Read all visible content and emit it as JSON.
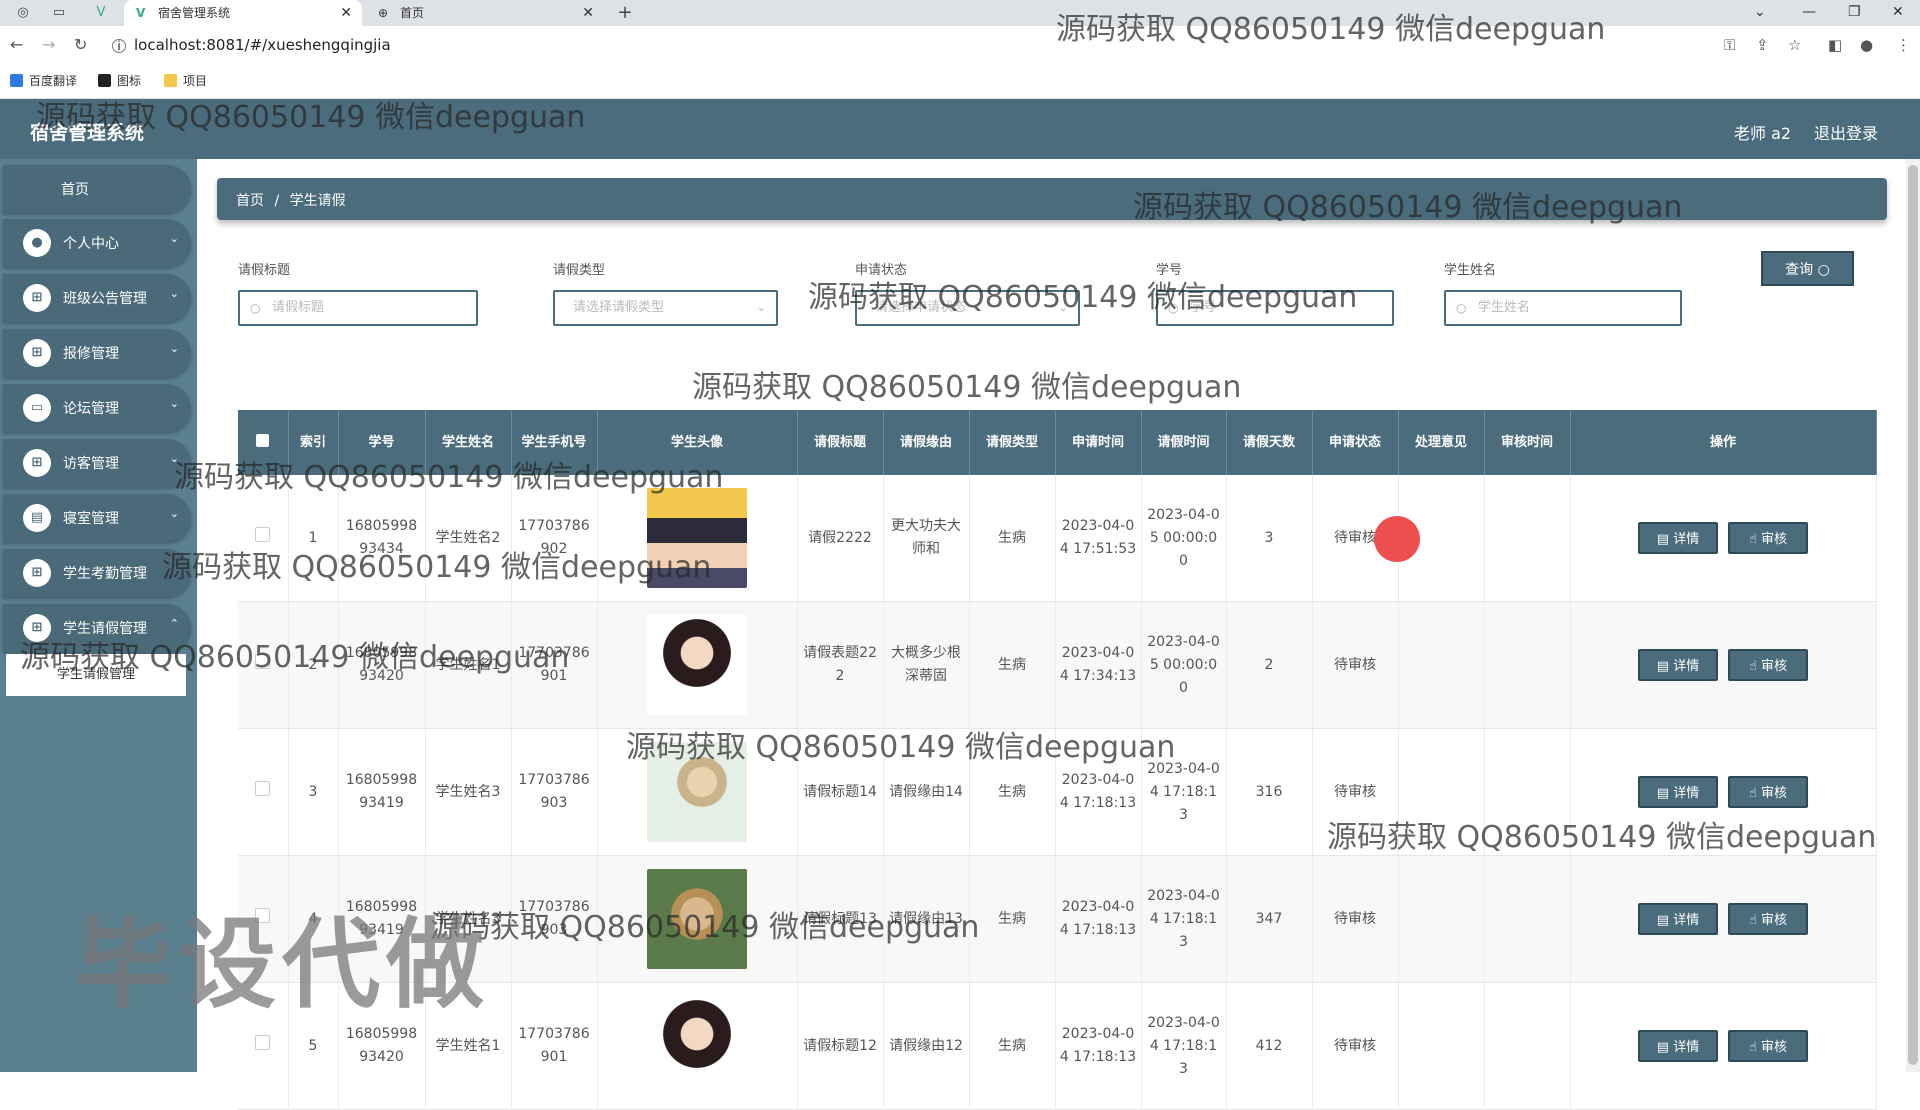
{
  "browser": {
    "tabs": [
      {
        "title": "宿舍管理系统",
        "close": "✕"
      },
      {
        "title": "首页",
        "close": "✕"
      }
    ],
    "new_tab": "+",
    "url": "localhost:8081/#/xueshengqingjia",
    "bookmarks": [
      "百度翻译",
      "图标",
      "项目"
    ]
  },
  "app": {
    "brand": "宿舍管理系统",
    "user": "老师 a2",
    "logout": "退出登录"
  },
  "sidebar": {
    "home": "首页",
    "items": [
      {
        "label": "个人中心"
      },
      {
        "label": "班级公告管理"
      },
      {
        "label": "报修管理"
      },
      {
        "label": "论坛管理"
      },
      {
        "label": "访客管理"
      },
      {
        "label": "寝室管理"
      },
      {
        "label": "学生考勤管理"
      },
      {
        "label": "学生请假管理"
      }
    ],
    "submenu": "学生请假管理"
  },
  "breadcrumb": {
    "home": "首页",
    "sep": "/",
    "current": "学生请假"
  },
  "filters": {
    "title_label": "请假标题",
    "title_placeholder": "请假标题",
    "type_label": "请假类型",
    "type_placeholder": "请选择请假类型",
    "status_label": "申请状态",
    "status_placeholder": "请选择申请状态",
    "id_label": "学号",
    "id_placeholder": "学号",
    "name_label": "学生姓名",
    "name_placeholder": "学生姓名",
    "query": "查询"
  },
  "table": {
    "headers": [
      "索引",
      "学号",
      "学生姓名",
      "学生手机号",
      "学生头像",
      "请假标题",
      "请假缘由",
      "请假类型",
      "申请时间",
      "请假时间",
      "请假天数",
      "申请状态",
      "处理意见",
      "审核时间",
      "操作"
    ],
    "detail_btn": "详情",
    "audit_btn": "审核",
    "rows": [
      {
        "idx": "1",
        "sid": "1680599893434",
        "name": "学生姓名2",
        "phone": "17703786902",
        "title": "请假2222",
        "reason": "更大功夫大师和",
        "type": "生病",
        "apply": "2023-04-04 17:51:53",
        "leave": "2023-04-05 00:00:00",
        "days": "3",
        "status": "待审核",
        "opinion": "",
        "audit_time": ""
      },
      {
        "idx": "2",
        "sid": "1680599893420",
        "name": "学生姓名1",
        "phone": "17703786901",
        "title": "请假表题222",
        "reason": "大概多少根深蒂固",
        "type": "生病",
        "apply": "2023-04-04 17:34:13",
        "leave": "2023-04-05 00:00:00",
        "days": "2",
        "status": "待审核",
        "opinion": "",
        "audit_time": ""
      },
      {
        "idx": "3",
        "sid": "1680599893419",
        "name": "学生姓名3",
        "phone": "17703786903",
        "title": "请假标题14",
        "reason": "请假缘由14",
        "type": "生病",
        "apply": "2023-04-04 17:18:13",
        "leave": "2023-04-04 17:18:13",
        "days": "316",
        "status": "待审核",
        "opinion": "",
        "audit_time": ""
      },
      {
        "idx": "4",
        "sid": "1680599893419",
        "name": "学生姓名3",
        "phone": "17703786903",
        "title": "请假标题13",
        "reason": "请假缘由13",
        "type": "生病",
        "apply": "2023-04-04 17:18:13",
        "leave": "2023-04-04 17:18:13",
        "days": "347",
        "status": "待审核",
        "opinion": "",
        "audit_time": ""
      },
      {
        "idx": "5",
        "sid": "1680599893420",
        "name": "学生姓名1",
        "phone": "17703786901",
        "title": "请假标题12",
        "reason": "请假缘由12",
        "type": "生病",
        "apply": "2023-04-04 17:18:13",
        "leave": "2023-04-04 17:18:13",
        "days": "412",
        "status": "待审核",
        "opinion": "",
        "audit_time": ""
      }
    ]
  },
  "watermark": {
    "text": "源码获取 QQ86050149 微信deepguan",
    "big": "毕设代做"
  },
  "colors": {
    "primary": "#4a6c7c",
    "sidebar": "#5a7f8e",
    "cursor": "#eb3c3c"
  }
}
